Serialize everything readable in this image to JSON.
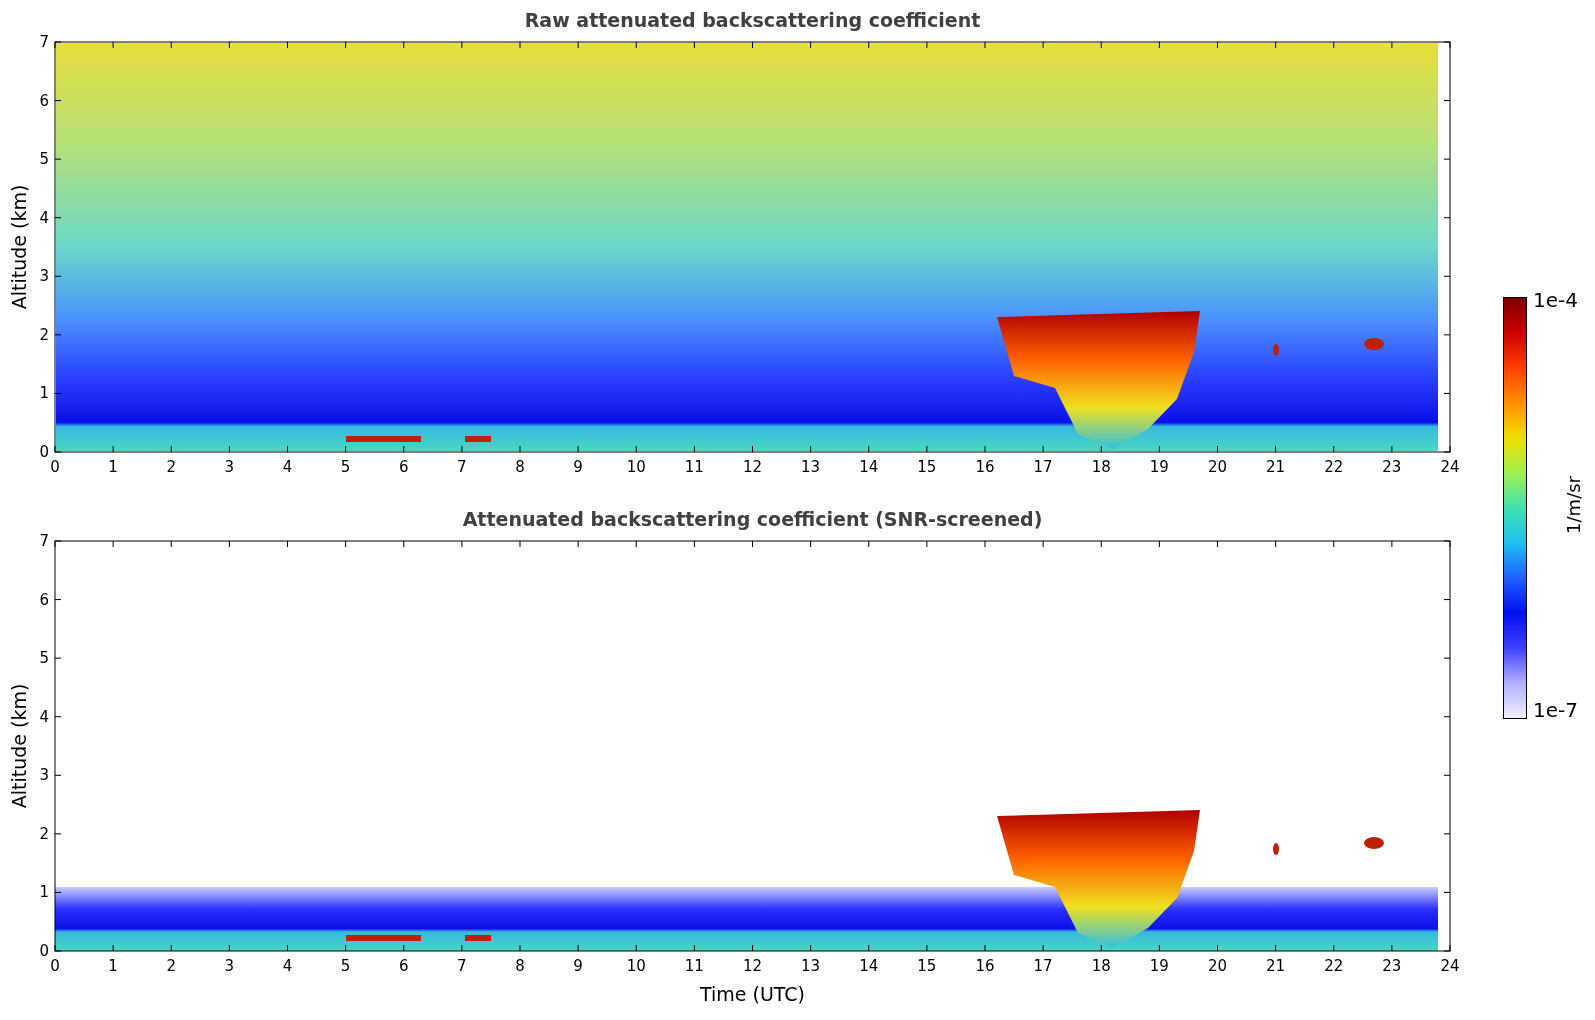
{
  "panels": [
    {
      "title": "Raw attenuated backscattering coefficient",
      "ylabel": "Altitude (km)",
      "yticks": [
        "7",
        "6",
        "5",
        "4",
        "3",
        "2",
        "1",
        "0"
      ],
      "xticks": [
        "0",
        "1",
        "2",
        "3",
        "4",
        "5",
        "6",
        "7",
        "8",
        "9",
        "10",
        "11",
        "12",
        "13",
        "14",
        "15",
        "16",
        "17",
        "18",
        "19",
        "20",
        "21",
        "22",
        "23",
        "24"
      ],
      "kind": "raw"
    },
    {
      "title": "Attenuated backscattering coefficient (SNR-screened)",
      "ylabel": "Altitude (km)",
      "yticks": [
        "7",
        "6",
        "5",
        "4",
        "3",
        "2",
        "1",
        "0"
      ],
      "xticks": [
        "0",
        "1",
        "2",
        "3",
        "4",
        "5",
        "6",
        "7",
        "8",
        "9",
        "10",
        "11",
        "12",
        "13",
        "14",
        "15",
        "16",
        "17",
        "18",
        "19",
        "20",
        "21",
        "22",
        "23",
        "24"
      ],
      "kind": "screened",
      "xlabel": "Time (UTC)"
    }
  ],
  "colorbar": {
    "max_label": "1e-4",
    "min_label": "1e-7",
    "label": "1/m/sr"
  }
}
